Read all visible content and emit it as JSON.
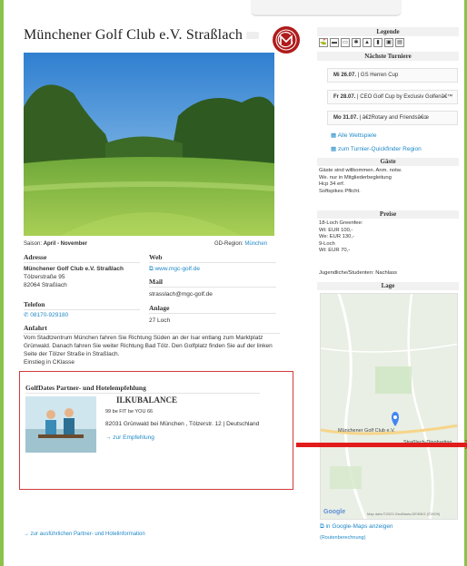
{
  "club": {
    "title": "Münchener Golf Club e.V. Straßlach",
    "season_label": "Saison:",
    "season_value": "April - November",
    "region_label": "GD-Region:",
    "region_value": "München"
  },
  "left": {
    "address_heading": "Adresse",
    "address_name": "Münchener Golf Club e.V. Straßlach",
    "address_street": "Tölzerstraße 95",
    "address_city": "82064 Straßlach",
    "phone_heading": "Telefon",
    "phone_value": "08170-929180",
    "web_heading": "Web",
    "web_value": "www.mgc-golf.de",
    "mail_heading": "Mail",
    "mail_value": "strasslach@mgc-golf.de",
    "facility_heading": "Anlage",
    "facility_value": "27 Loch",
    "directions_heading": "Anfahrt",
    "directions_text": "Vom Stadtzentrum München fahren Sie Richtung Süden an der Isar entlang zum Marktplatz Grünwald. Danach fahren Sie weiter Richtung Bad Tölz. Den Golfplatz finden Sie auf der linken Seite der Tölzer Straße in Straßlach.",
    "entrance_text": "Einstieg in CKlasse"
  },
  "partner": {
    "heading": "GolfDates Partner- und Hotelempfehlung",
    "name": "ILKUBALANCE",
    "tagline": "99 be FIT be YOU 66",
    "address": "82031 Grünwald bei München , Tölzerstr. 12 | Deutschland",
    "link": "→ zur Empfehlung"
  },
  "footer": {
    "link": "→ zur ausführlichen Partner- und Hotelinformation"
  },
  "right": {
    "legend_heading": "Legende",
    "legend_icons": [
      "⛳",
      "▬",
      "▭",
      "✱",
      "▲",
      "▮",
      "▣",
      "▤"
    ],
    "tournaments_heading": "Nächste Turniere",
    "tournaments": [
      {
        "day": "Mi",
        "date": "26.07.",
        "name": "| GS Herren Cup"
      },
      {
        "day": "Fr",
        "date": "28.07.",
        "name": "| CEO Golf Cup by Exclusiv Golfenâ€™"
      },
      {
        "day": "Mo",
        "date": "31.07.",
        "name": "| â€žRotary and Friendsâ€œ"
      }
    ],
    "all_games": "Alle Wettspiele",
    "quickfinder": "zum Turnier-Quickfinder Region",
    "guests_heading": "Gäste",
    "guests_lines": [
      "Gäste sind willkommen. Anm. notw.",
      "We. nur in Mitgliederbegleitung",
      "Hcp 34 erf.",
      "Softspikes Pflicht."
    ],
    "prices_heading": "Preise",
    "prices_lines": [
      "18-Loch Greenfee:",
      "Wt: EUR 100,-",
      "We: EUR 130,-",
      "9-Loch",
      "Wt: EUR 70,-"
    ],
    "youth": "Jugendliche/Studenten: Nachlass",
    "location_heading": "Lage",
    "map_label": "Münchener Golf Club e.V.",
    "map_road": "Straßlach-Dingharting",
    "map_google": "Google",
    "map_copyright": "Map data ©2023 GeoBasis-DE/BKG (©2009)",
    "maps_link": "in Google-Maps anzeigen",
    "route": "(Routenberechnung)"
  },
  "colors": {
    "accent_green": "#8bc34a",
    "link_blue": "#1e88c7",
    "highlight_red": "#d23b3b"
  }
}
